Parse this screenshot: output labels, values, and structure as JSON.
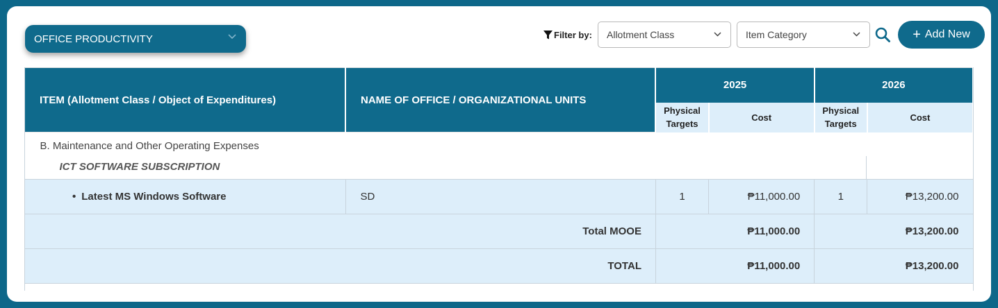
{
  "program_select": {
    "value": "OFFICE PRODUCTIVITY"
  },
  "filter": {
    "label": "Filter by:",
    "allotment_class": "Allotment Class",
    "item_category": "Item Category"
  },
  "add_button": {
    "label": "Add New"
  },
  "table": {
    "headers": {
      "item": "ITEM (Allotment Class / Object of Expenditures)",
      "office": "NAME OF OFFICE / ORGANIZATIONAL UNITS",
      "year1": "2025",
      "year2": "2026",
      "physical_targets": "Physical Targets",
      "cost": "Cost"
    },
    "category": "B. Maintenance and Other Operating Expenses",
    "subcategory": "ICT SOFTWARE SUBSCRIPTION",
    "rows": [
      {
        "bullet": "•",
        "item": "Latest MS Windows Software",
        "office": "SD",
        "y1_targets": "1",
        "y1_cost": "₱11,000.00",
        "y2_targets": "1",
        "y2_cost": "₱13,200.00"
      }
    ],
    "total_mooe": {
      "label": "Total MOOE",
      "y1": "₱11,000.00",
      "y2": "₱13,200.00"
    },
    "total": {
      "label": "TOTAL",
      "y1": "₱11,000.00",
      "y2": "₱13,200.00"
    }
  },
  "icons": {
    "filter": "filter-icon",
    "chevron": "chevron-down-icon",
    "search": "search-icon",
    "plus": "plus-icon"
  },
  "colors": {
    "brand": "#0f6a8c",
    "background": "#0d6789",
    "row_highlight": "#ddeefa"
  }
}
